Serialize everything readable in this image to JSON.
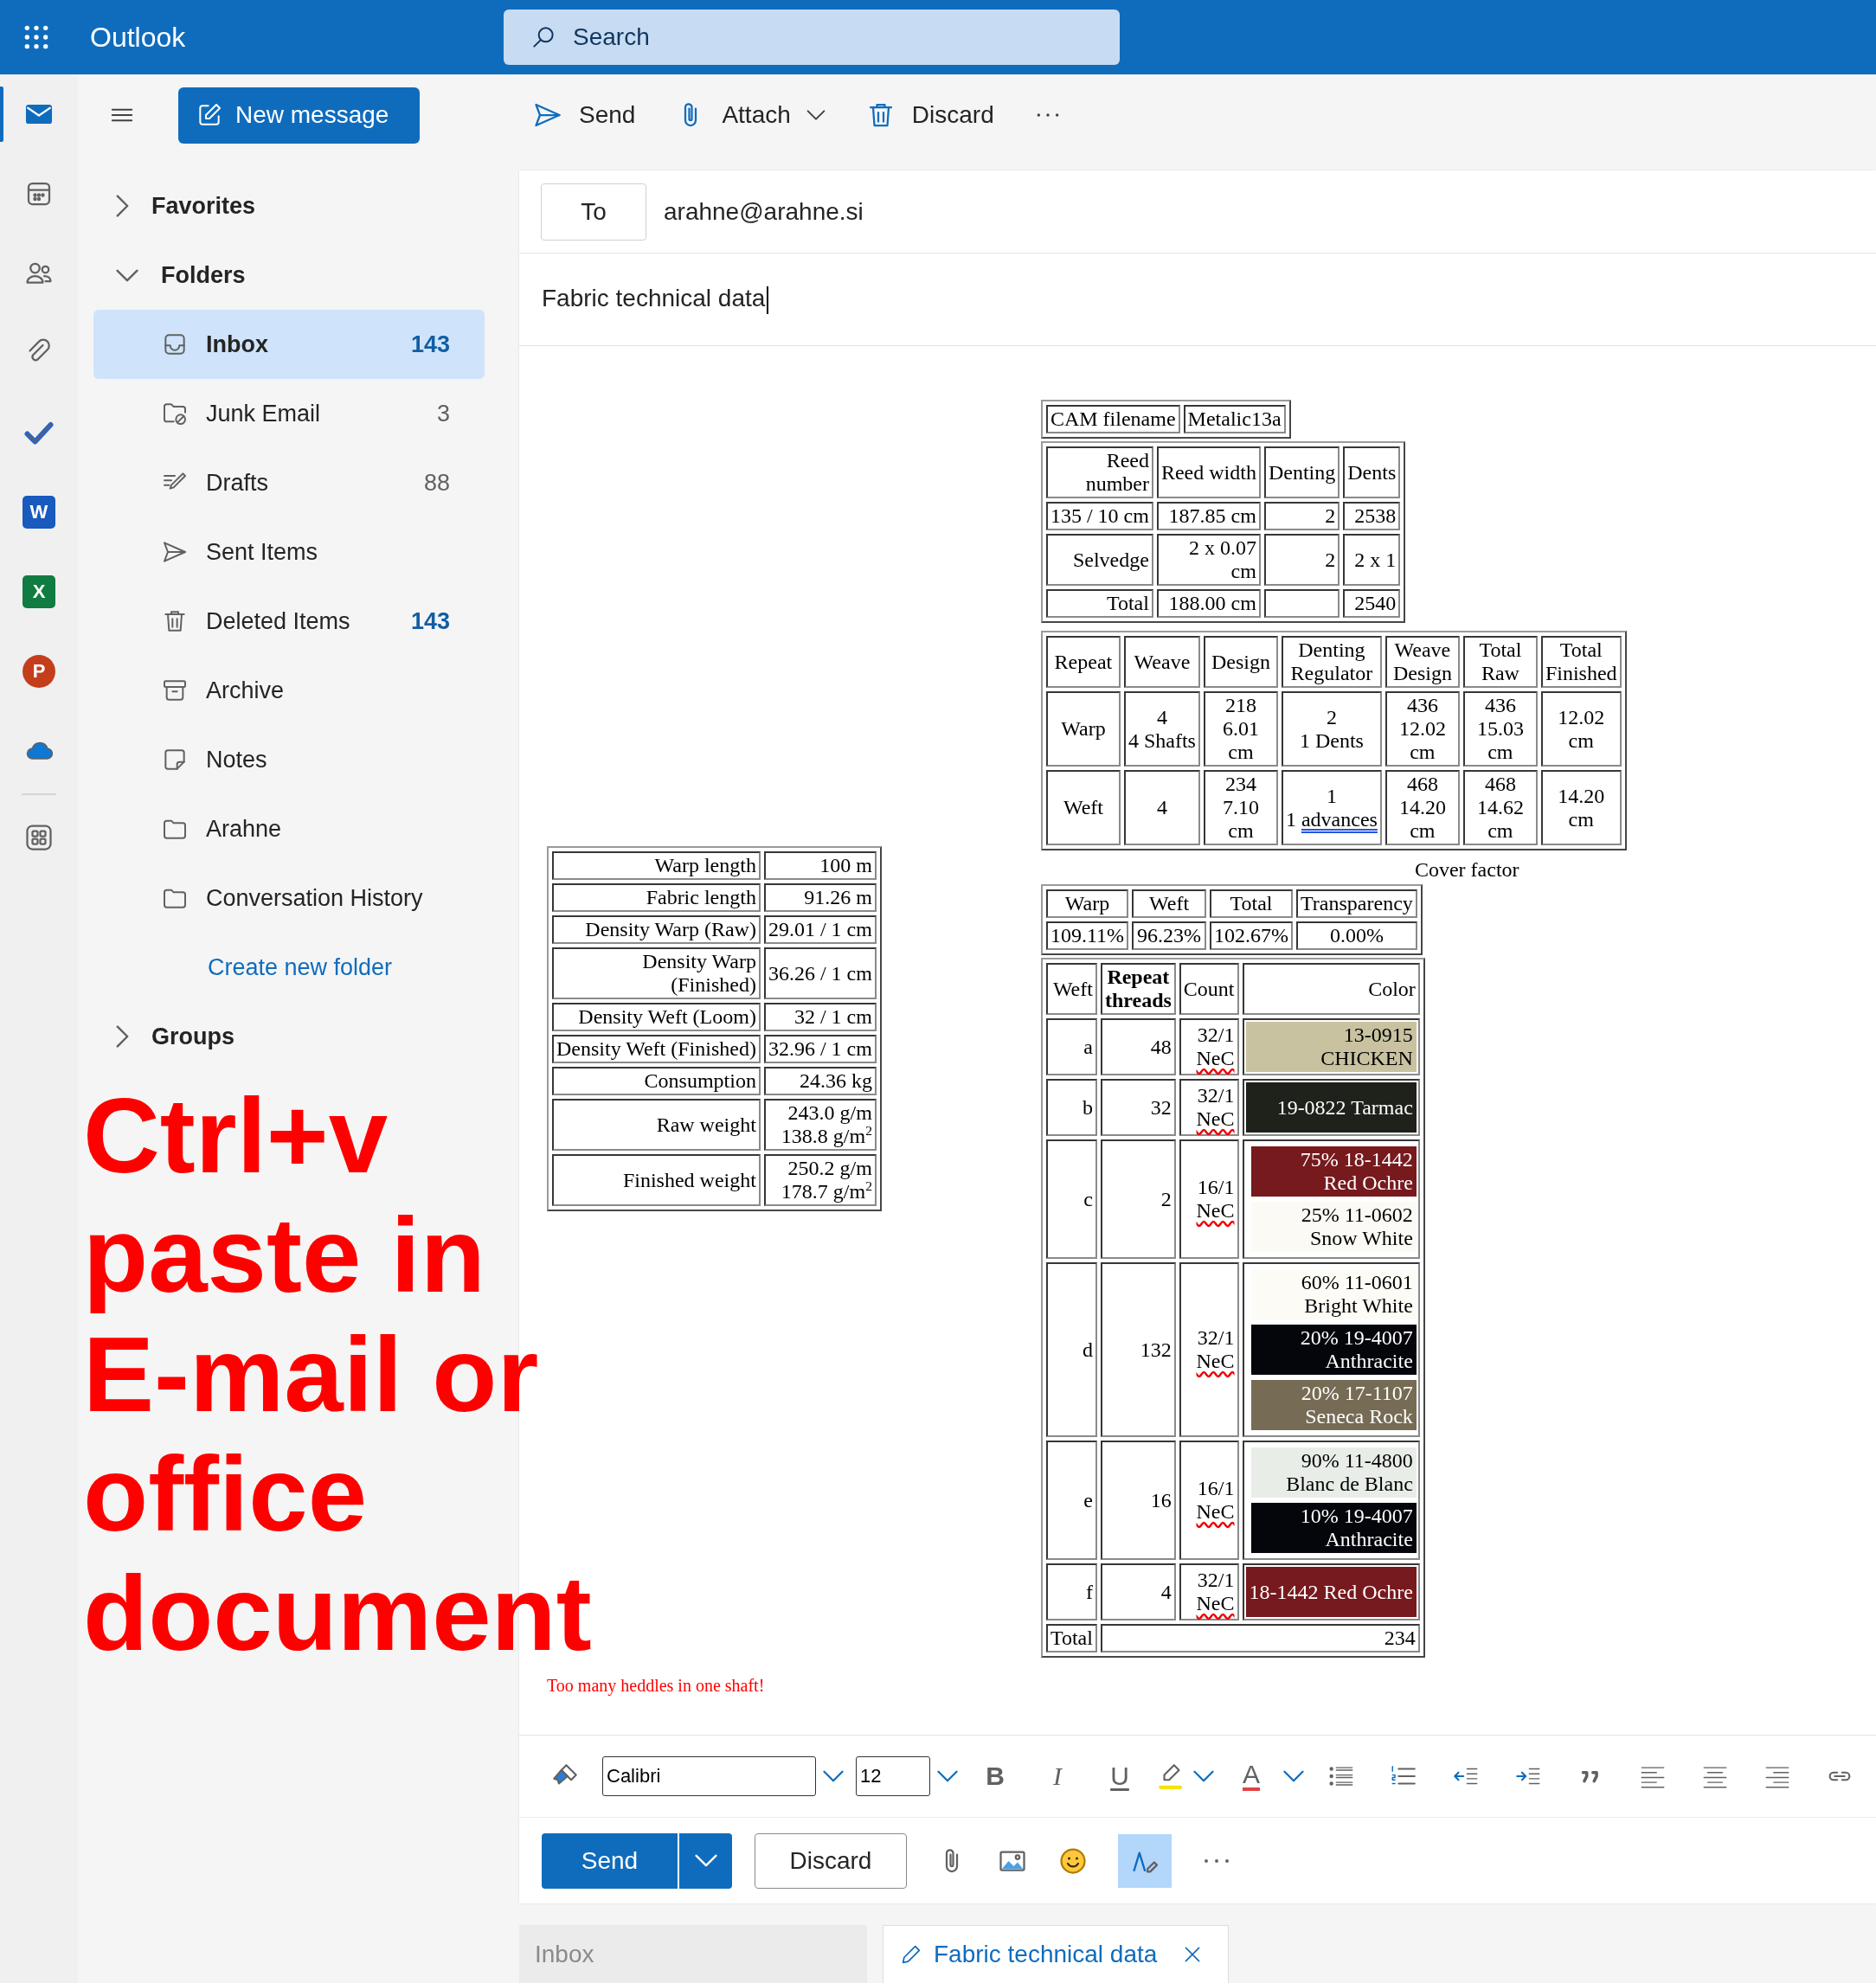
{
  "header": {
    "app_name": "Outlook",
    "search_placeholder": "Search"
  },
  "rail": [
    {
      "kind": "mail",
      "selected": true
    },
    {
      "kind": "calendar",
      "selected": false
    },
    {
      "kind": "people",
      "selected": false
    },
    {
      "kind": "files",
      "selected": false
    },
    {
      "kind": "todo",
      "selected": false
    },
    {
      "kind": "word",
      "label": "W",
      "selected": false
    },
    {
      "kind": "excel",
      "label": "X",
      "selected": false
    },
    {
      "kind": "powerpoint",
      "label": "P",
      "selected": false
    },
    {
      "kind": "onedrive",
      "selected": false
    },
    {
      "kind": "apps",
      "selected": false
    }
  ],
  "new_message": "New message",
  "toolbar": [
    {
      "kind": "send",
      "label": "Send"
    },
    {
      "kind": "attach",
      "label": "Attach"
    },
    {
      "kind": "discard",
      "label": "Discard"
    },
    {
      "kind": "more"
    }
  ],
  "nav": [
    {
      "label": "Favorites",
      "expanded": false
    },
    {
      "label": "Folders",
      "expanded": true,
      "folders": [
        {
          "kind": "inbox",
          "label": "Inbox",
          "count": "143",
          "unread": true,
          "selected": true
        },
        {
          "kind": "junk",
          "label": "Junk Email",
          "count": "3",
          "unread": false,
          "selected": false
        },
        {
          "kind": "drafts",
          "label": "Drafts",
          "count": "88",
          "unread": false,
          "selected": false
        },
        {
          "kind": "sent",
          "label": "Sent Items",
          "selected": false
        },
        {
          "kind": "deleted",
          "label": "Deleted Items",
          "count": "143",
          "unread": true,
          "selected": false
        },
        {
          "kind": "archive",
          "label": "Archive",
          "selected": false
        },
        {
          "kind": "notes",
          "label": "Notes",
          "selected": false
        },
        {
          "kind": "folder",
          "label": "Arahne",
          "selected": false
        },
        {
          "kind": "folder",
          "label": "Conversation History",
          "selected": false
        }
      ],
      "link": "Create new folder"
    },
    {
      "label": "Groups",
      "expanded": false
    }
  ],
  "compose": {
    "to_button": "To",
    "recipient": "arahne@arahne.si",
    "subject": "Fabric technical data",
    "fabric_table": [
      {
        "label": "Warp length",
        "value": "100 m"
      },
      {
        "label": "Fabric length",
        "value": "91.26 m"
      },
      {
        "label": "Density Warp (Raw)",
        "value": "29.01 / 1 cm"
      },
      {
        "label": "Density Warp\n(Finished)",
        "value": "36.26 / 1 cm"
      },
      {
        "label": "Density Weft (Loom)",
        "value": "32 / 1 cm"
      },
      {
        "label": "Density Weft (Finished)",
        "value": "32.96 / 1 cm"
      },
      {
        "label": "Consumption",
        "value": "24.36 kg"
      },
      {
        "label": "Raw weight",
        "value": "243.0 g/m\n138.8 g/m$^{2}$"
      },
      {
        "label": "Finished weight",
        "value": "250.2 g/m\n178.7 g/m$^{2}$"
      }
    ],
    "cam_table": {
      "rows": [
        [
          "CAM filename",
          "Metalic13a"
        ]
      ]
    },
    "reed_table": {
      "columns": [
        "Reed\nnumber",
        "Reed width",
        "Denting",
        "Dents"
      ],
      "rows": [
        [
          "135 / 10 cm",
          "187.85 cm",
          "2",
          "2538"
        ],
        [
          "Selvedge",
          "2 x 0.07\ncm",
          "2",
          "2 x 1"
        ],
        [
          "Total",
          "188.00 cm",
          null,
          "2540"
        ]
      ]
    },
    "repeat_table": {
      "columns": [
        "Repeat",
        "Weave",
        "Design",
        "Denting\nRegulator",
        "Weave\nDesign",
        "Total\nRaw",
        "Total\nFinished"
      ],
      "rows": [
        [
          "Warp",
          "4\n4 Shafts",
          "218\n6.01\ncm",
          "2\n1 Dents",
          "436\n12.02\ncm",
          "436\n15.03\ncm",
          "12.02\ncm"
        ],
        [
          "Weft",
          "4",
          "234\n7.10\ncm",
          {
            "text": "1\n1 ",
            "flagged": "advances",
            "kind": "grammar"
          },
          "468\n14.20\ncm",
          "468\n14.62\ncm",
          "14.20\ncm"
        ]
      ]
    },
    "cover_factor": {
      "caption": "Cover factor",
      "columns": [
        "Warp",
        "Weft",
        "Total",
        "Transparency"
      ],
      "rows": [
        [
          "109.11%",
          "96.23%",
          "102.67%",
          "0.00%"
        ]
      ]
    },
    "weft_table": {
      "columns": [
        {
          "label": "Weft",
          "bold": false
        },
        {
          "label": "Repeat\nthreads",
          "bold": true
        },
        {
          "label": "Count",
          "bold": false
        },
        {
          "label": "Color",
          "bold": false
        }
      ],
      "rows": [
        {
          "weft": "a",
          "repeat": "48",
          "count": {
            "text": "32/1\n",
            "flagged": "NeC",
            "kind": "spelling"
          },
          "colors": [
            {
              "label": "13-0915\nCHICKEN",
              "color": "#c8c2a0"
            }
          ]
        },
        {
          "weft": "b",
          "repeat": "32",
          "count": {
            "text": "32/1\n",
            "flagged": "NeC",
            "kind": "spelling"
          },
          "colors": [
            {
              "label": "19-0822 Tarmac",
              "color": "#1f211b"
            }
          ]
        },
        {
          "weft": "c",
          "repeat": "2",
          "count": {
            "text": "16/1\n",
            "flagged": "NeC",
            "kind": "spelling"
          },
          "colors": [
            {
              "label": "75% 18-1442\nRed Ochre",
              "color": "#761a1e"
            },
            {
              "label": "25% 11-0602\nSnow White",
              "color": "#fbfaf4"
            }
          ]
        },
        {
          "weft": "d",
          "repeat": "132",
          "count": {
            "text": "32/1\n",
            "flagged": "NeC",
            "kind": "spelling"
          },
          "colors": [
            {
              "label": "60% 11-0601\nBright White",
              "color": "#fcfbf6"
            },
            {
              "label": "20% 19-4007\nAnthracite",
              "color": "#05060b"
            },
            {
              "label": "20% 17-1107\nSeneca Rock",
              "color": "#766b55"
            }
          ]
        },
        {
          "weft": "e",
          "repeat": "16",
          "count": {
            "text": "16/1\n",
            "flagged": "NeC",
            "kind": "spelling"
          },
          "colors": [
            {
              "label": "90% 11-4800\nBlanc de Blanc",
              "color": "#e8ede8"
            },
            {
              "label": "10% 19-4007\nAnthracite",
              "color": "#05060b"
            }
          ]
        },
        {
          "weft": "f",
          "repeat": "4",
          "count": {
            "text": "32/1\n",
            "flagged": "NeC",
            "kind": "spelling"
          },
          "colors": [
            {
              "label": "18-1442 Red Ochre",
              "color": "#761a1e"
            }
          ]
        }
      ],
      "total": {
        "label": "Total",
        "value": "234"
      }
    },
    "warning": "Too many heddles in one shaft!",
    "format_bar": {
      "font": "Calibri",
      "size": "12",
      "tools": [
        {
          "kind": "format_painter"
        },
        {
          "kind": "bold",
          "label": "B"
        },
        {
          "kind": "italic",
          "label": "I"
        },
        {
          "kind": "underline",
          "label": "U"
        },
        {
          "kind": "highlight"
        },
        {
          "kind": "font_color",
          "label": "A"
        },
        {
          "kind": "bullets"
        },
        {
          "kind": "numbering"
        },
        {
          "kind": "outdent"
        },
        {
          "kind": "indent"
        },
        {
          "kind": "quote"
        },
        {
          "kind": "align_left"
        },
        {
          "kind": "align_center"
        },
        {
          "kind": "align_right"
        },
        {
          "kind": "link"
        }
      ]
    },
    "actions": {
      "send": "Send",
      "discard": "Discard",
      "tools": [
        {
          "kind": "attach",
          "selected": false
        },
        {
          "kind": "image",
          "selected": false
        },
        {
          "kind": "emoji",
          "selected": false
        },
        {
          "kind": "editor",
          "selected": true
        },
        {
          "kind": "more",
          "selected": false
        }
      ]
    }
  },
  "tabs": [
    {
      "kind": "folder",
      "label": "Inbox",
      "selected": false
    },
    {
      "kind": "draft",
      "label": "Fabric technical data",
      "selected": true
    }
  ],
  "overlay_note": [
    "Ctrl+v",
    "paste in",
    "E-mail or",
    "office",
    "document"
  ]
}
